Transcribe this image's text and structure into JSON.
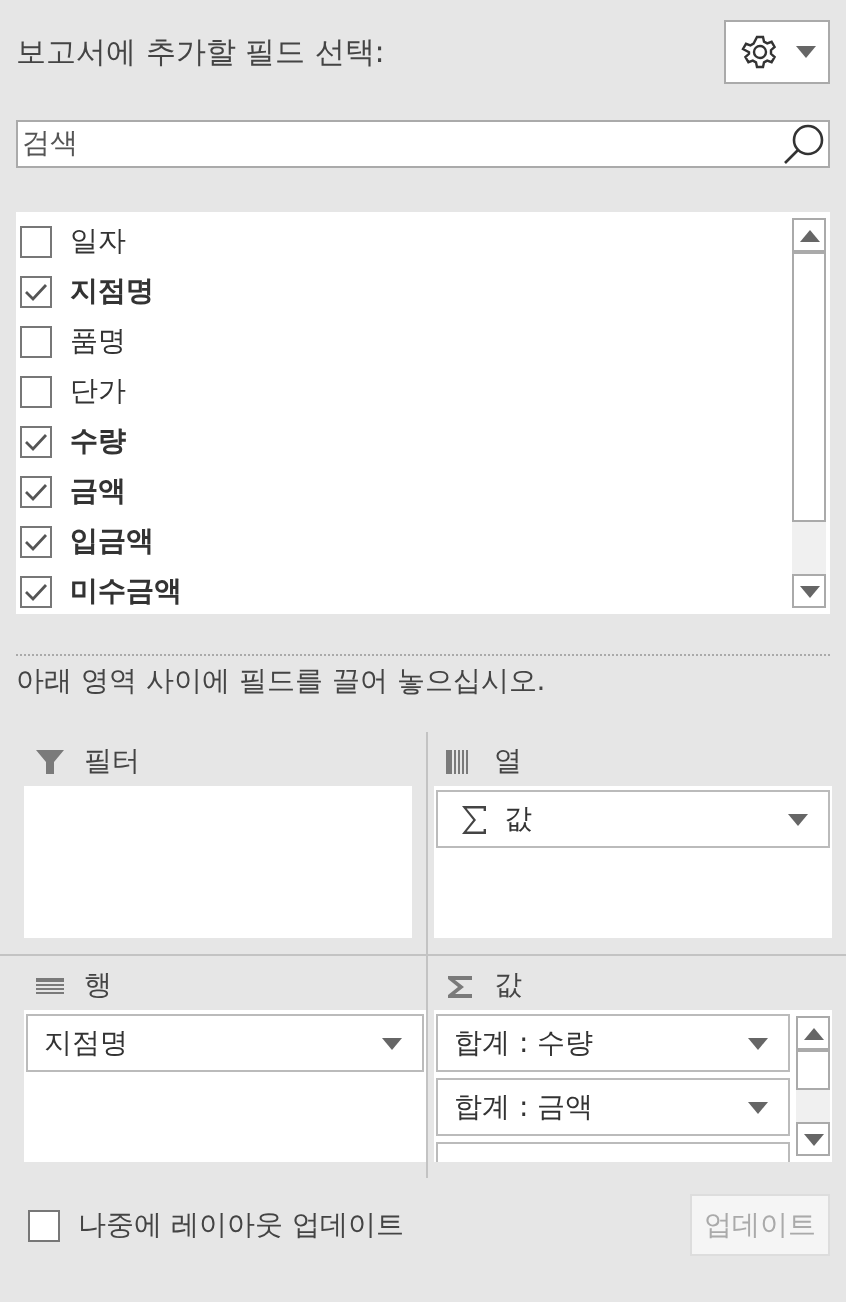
{
  "pane": {
    "title": "보고서에 추가할 필드 선택:"
  },
  "search": {
    "placeholder": "검색"
  },
  "fields": [
    {
      "name": "일자",
      "checked": false
    },
    {
      "name": "지점명",
      "checked": true
    },
    {
      "name": "품명",
      "checked": false
    },
    {
      "name": "단가",
      "checked": false
    },
    {
      "name": "수량",
      "checked": true
    },
    {
      "name": "금액",
      "checked": true
    },
    {
      "name": "입금액",
      "checked": true
    },
    {
      "name": "미수금액",
      "checked": true
    }
  ],
  "instruction": "아래 영역 사이에 필드를 끌어 놓으십시오.",
  "areas": [
    {
      "kind": "filter",
      "title": "필터"
    },
    {
      "kind": "columns",
      "title": "열",
      "items": [
        {
          "label": "값",
          "sigma": true
        }
      ]
    },
    {
      "kind": "rows",
      "title": "행",
      "items": [
        {
          "label": "지점명"
        }
      ]
    },
    {
      "kind": "values",
      "title": "값",
      "items": [
        {
          "label": "합계 : 수량"
        },
        {
          "label": "합계 : 금액"
        }
      ],
      "cut_off": true
    }
  ],
  "defer_update": {
    "label": "나중에 레이아웃 업데이트",
    "checked": false
  },
  "update_button": {
    "label": "업데이트",
    "disabled": true
  }
}
